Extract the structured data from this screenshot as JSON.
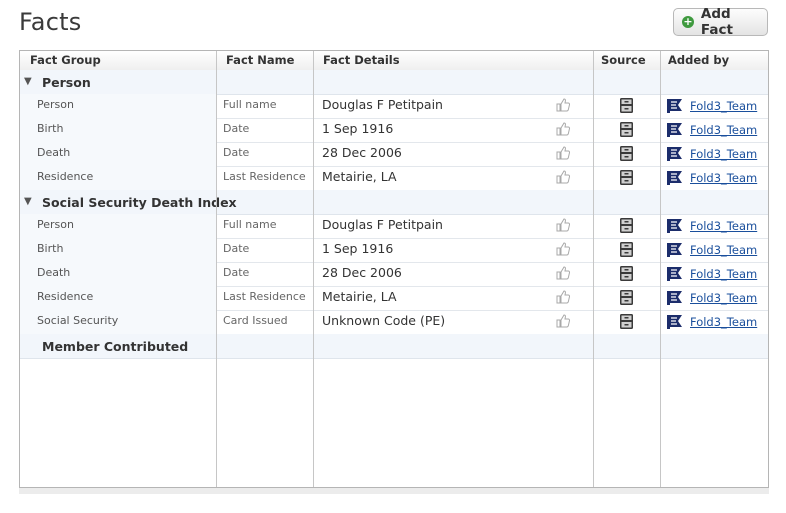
{
  "page": {
    "title": "Facts",
    "add_button": "Add Fact"
  },
  "columns": [
    "Fact Group",
    "Fact Name",
    "Fact Details",
    "Source",
    "Added by"
  ],
  "sections": [
    {
      "label": "Person",
      "rows": [
        {
          "group": "Person",
          "name": "Full name",
          "detail": "Douglas F Petitpain",
          "added_by": "Fold3_Team"
        },
        {
          "group": "Birth",
          "name": "Date",
          "detail": "1 Sep 1916",
          "added_by": "Fold3_Team"
        },
        {
          "group": "Death",
          "name": "Date",
          "detail": "28 Dec 2006",
          "added_by": "Fold3_Team"
        },
        {
          "group": "Residence",
          "name": "Last Residence",
          "detail": "Metairie, LA",
          "added_by": "Fold3_Team"
        }
      ]
    },
    {
      "label": "Social Security Death Index",
      "rows": [
        {
          "group": "Person",
          "name": "Full name",
          "detail": "Douglas F Petitpain",
          "added_by": "Fold3_Team"
        },
        {
          "group": "Birth",
          "name": "Date",
          "detail": "1 Sep 1916",
          "added_by": "Fold3_Team"
        },
        {
          "group": "Death",
          "name": "Date",
          "detail": "28 Dec 2006",
          "added_by": "Fold3_Team"
        },
        {
          "group": "Residence",
          "name": "Last Residence",
          "detail": "Metairie, LA",
          "added_by": "Fold3_Team"
        },
        {
          "group": "Social Security",
          "name": "Card Issued",
          "detail": "Unknown Code (PE)",
          "added_by": "Fold3_Team"
        }
      ]
    }
  ],
  "member_contributed": {
    "label": "Member Contributed"
  },
  "icons": {
    "add": "plus-circle-icon",
    "expand": "triangle-down-icon",
    "like": "thumbs-up-icon",
    "source": "file-cabinet-icon",
    "user": "fold3-flag-icon"
  },
  "colors": {
    "link": "#1a4f9c",
    "section_bg": "#f2f6fb",
    "add_icon": "#3f9a3f",
    "flag": "#1c2d6b"
  }
}
